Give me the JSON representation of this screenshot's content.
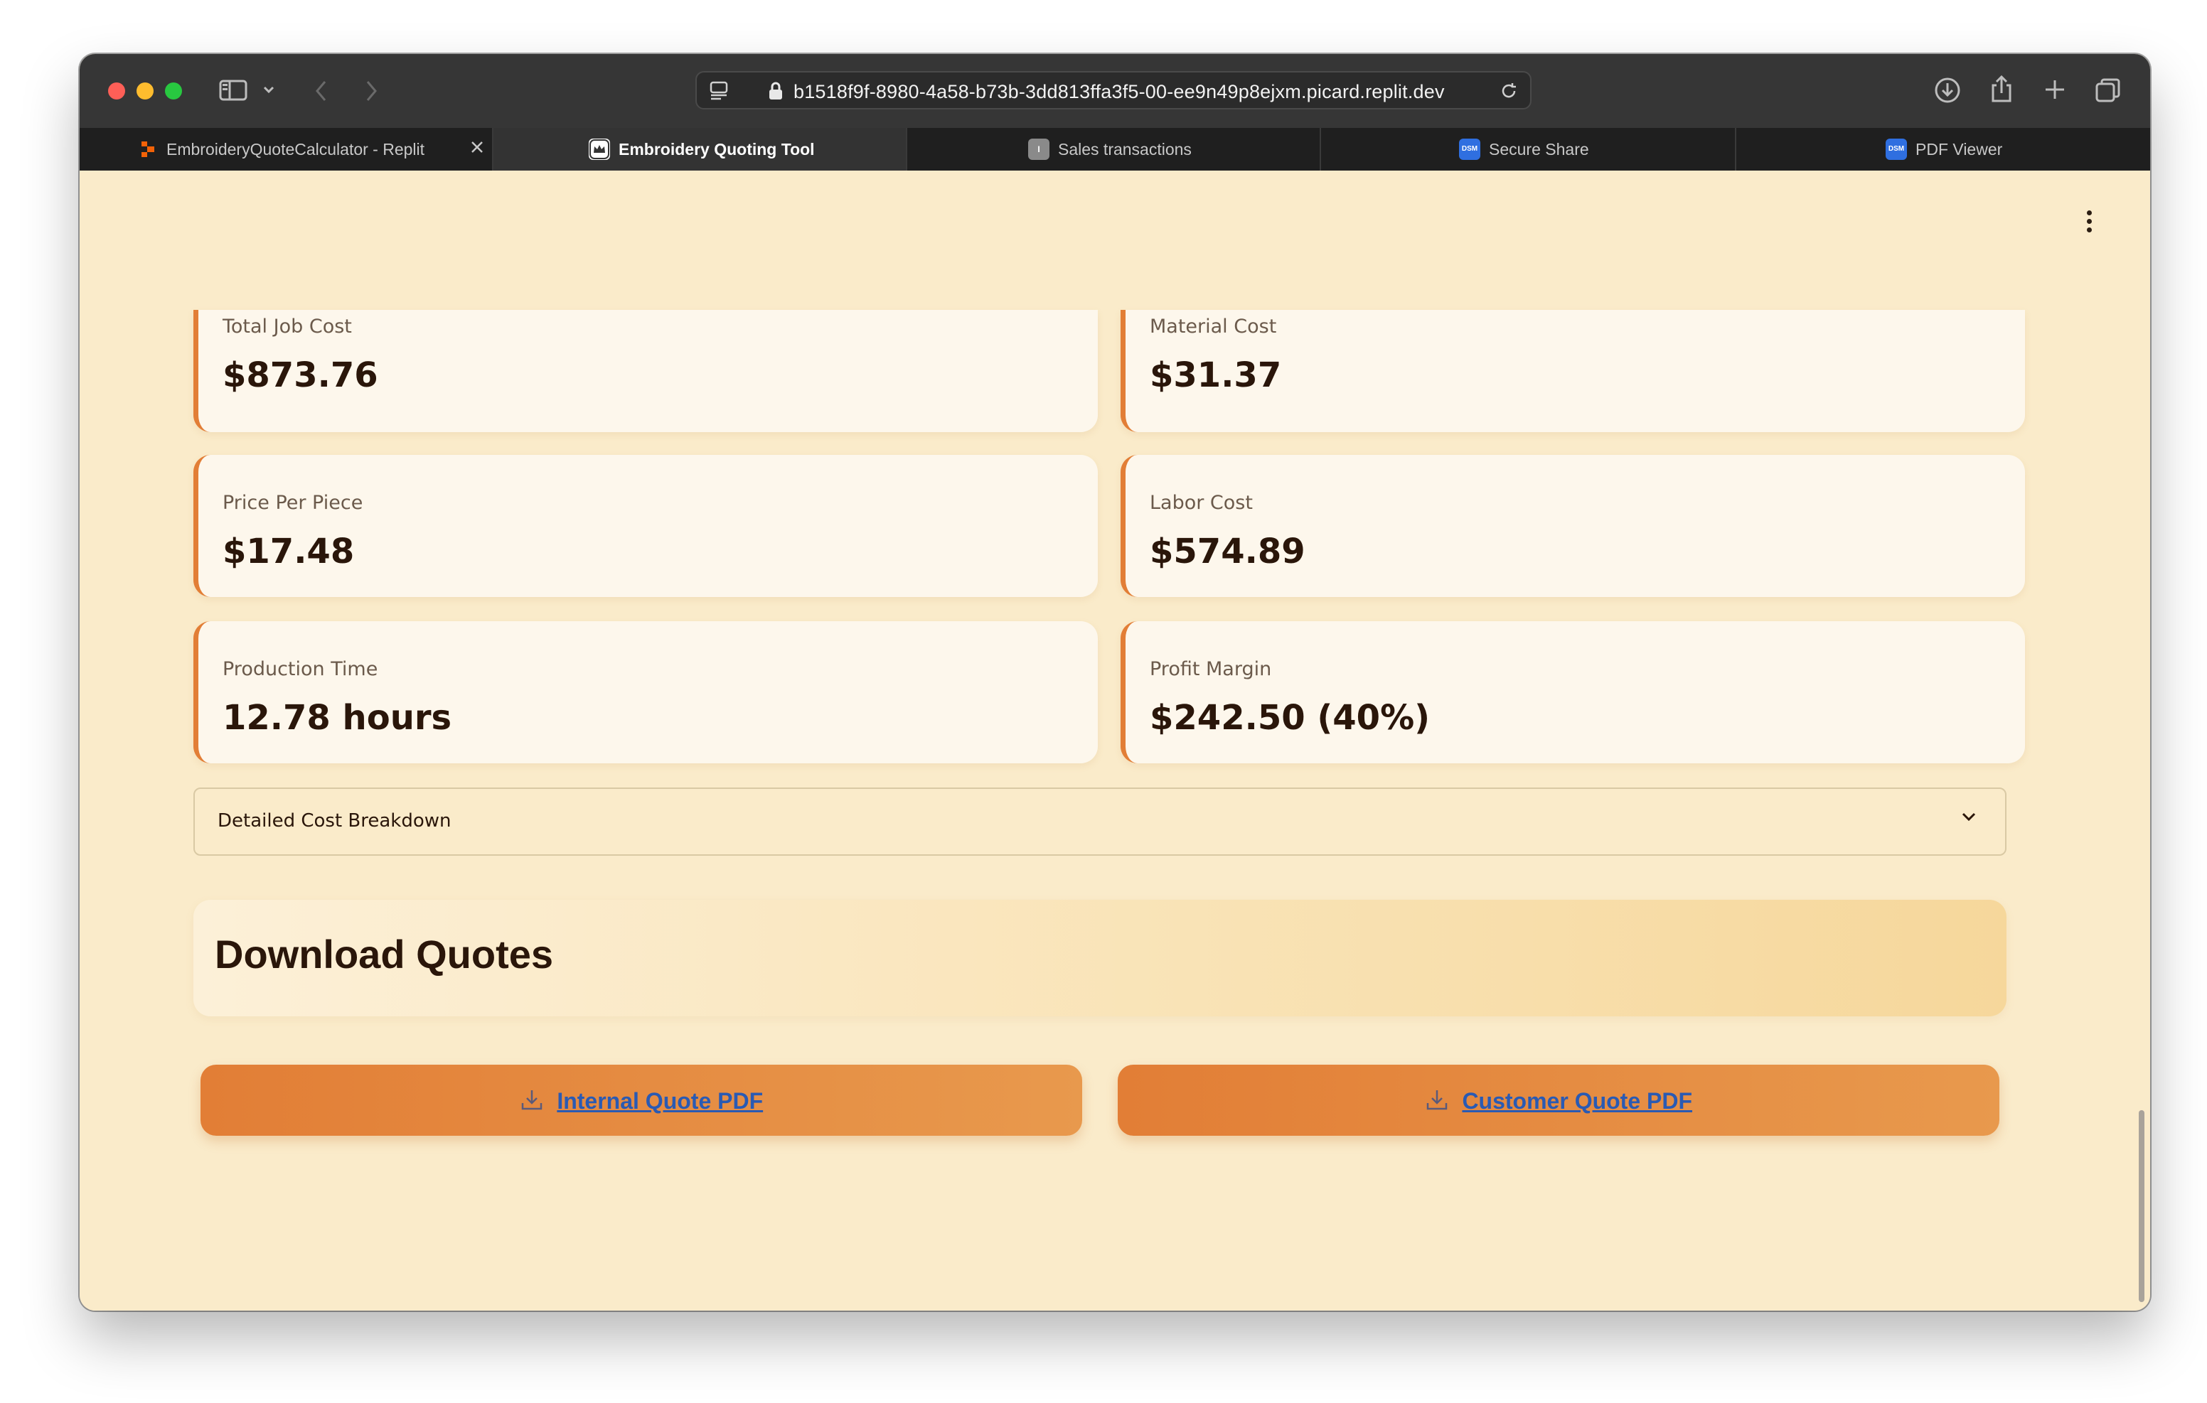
{
  "browser": {
    "url": "b1518f9f-8980-4a58-b73b-3dd813ffa3f5-00-ee9n49p8ejxm.picard.replit.dev",
    "tabs": [
      {
        "label": "EmbroideryQuoteCalculator - Replit",
        "active": false,
        "favicon": "replit-icon"
      },
      {
        "label": "Embroidery Quoting Tool",
        "active": true,
        "favicon": "crown-icon"
      },
      {
        "label": "Sales transactions",
        "active": false,
        "favicon": "i-icon",
        "favicon_text": "I"
      },
      {
        "label": "Secure Share",
        "active": false,
        "favicon": "dsm-icon",
        "favicon_text": "DSM"
      },
      {
        "label": "PDF Viewer",
        "active": false,
        "favicon": "dsm-icon",
        "favicon_text": "DSM"
      }
    ]
  },
  "metrics": [
    {
      "label": "Total Job Cost",
      "value": "$873.76"
    },
    {
      "label": "Material Cost",
      "value": "$31.37"
    },
    {
      "label": "Price Per Piece",
      "value": "$17.48"
    },
    {
      "label": "Labor Cost",
      "value": "$574.89"
    },
    {
      "label": "Production Time",
      "value": "12.78 hours"
    },
    {
      "label": "Profit Margin",
      "value": "$242.50 (40%)"
    }
  ],
  "breakdown": {
    "label": "Detailed Cost Breakdown"
  },
  "download": {
    "title": "Download Quotes",
    "internal_label": "Internal Quote PDF",
    "customer_label": "Customer Quote PDF"
  },
  "colors": {
    "page_bg": "#faebca",
    "accent": "#e27e36",
    "link": "#2a5ab3"
  }
}
